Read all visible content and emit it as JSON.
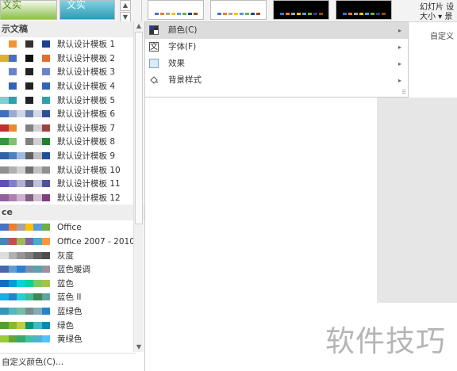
{
  "ribbon": {
    "thumb1_text": "文实",
    "thumb2_text": "文实",
    "slide_size_line1": "幻灯片 设",
    "slide_size_line2": "大小 ▾ 景",
    "group_label": "自定义"
  },
  "sections": {
    "document": "示文稿",
    "office": "ce"
  },
  "document_themes": [
    {
      "label": "默认设计模板 1",
      "colors": [
        "#ffffff",
        "#f29530",
        "#ffffff",
        "#333333",
        "#ffffff",
        "#1f3f8f"
      ]
    },
    {
      "label": "默认设计模板 2",
      "colors": [
        "#e0b030",
        "#4a6fc0",
        "#ffffff",
        "#111111",
        "#ffffff",
        "#e07030"
      ]
    },
    {
      "label": "默认设计模板 3",
      "colors": [
        "#ffffff",
        "#6b83c8",
        "#ffffff",
        "#222222",
        "#ffffff",
        "#6b83c8"
      ]
    },
    {
      "label": "默认设计模板 4",
      "colors": [
        "#ffffff",
        "#3264b4",
        "#ffffff",
        "#222222",
        "#ffffff",
        "#3264b4"
      ]
    },
    {
      "label": "默认设计模板 5",
      "colors": [
        "#7fcfcf",
        "#30a0a8",
        "#ffffff",
        "#222222",
        "#ffffff",
        "#30a0a8"
      ]
    },
    {
      "label": "默认设计模板 6",
      "colors": [
        "#3f6fbf",
        "#9aaad0",
        "#cfd6e8",
        "#7080b0",
        "#d0d8e8",
        "#304e98"
      ]
    },
    {
      "label": "默认设计模板 7",
      "colors": [
        "#c03030",
        "#e09030",
        "#ffffff",
        "#808080",
        "#d0d0d0",
        "#a04040"
      ]
    },
    {
      "label": "默认设计模板 8",
      "colors": [
        "#2f9a3a",
        "#80c070",
        "#ffffff",
        "#808080",
        "#d0d0d0",
        "#208030"
      ]
    },
    {
      "label": "默认设计模板 9",
      "colors": [
        "#3060a8",
        "#5080c0",
        "#a0b8e0",
        "#606060",
        "#c0c0c0",
        "#204e98"
      ]
    },
    {
      "label": "默认设计模板 10",
      "colors": [
        "#909090",
        "#b0b0b0",
        "#d0d0d0",
        "#707070",
        "#c0c0c0",
        "#909090"
      ]
    },
    {
      "label": "默认设计模板 11",
      "colors": [
        "#6050b0",
        "#8080c0",
        "#b0b0d0",
        "#606080",
        "#c0c0e0",
        "#5050a0"
      ]
    },
    {
      "label": "默认设计模板 12",
      "colors": [
        "#9060a0",
        "#b080b0",
        "#d0b0d0",
        "#806080",
        "#d0c0d0",
        "#804080"
      ]
    }
  ],
  "office_themes": [
    {
      "label": "Office",
      "colors": [
        "#4472c4",
        "#ed7d31",
        "#a5a5a5",
        "#ffc000",
        "#5b9bd5",
        "#70ad47"
      ]
    },
    {
      "label": "Office 2007 - 2010",
      "colors": [
        "#4f81bd",
        "#c0504d",
        "#9bbb59",
        "#8064a2",
        "#4bacc6",
        "#f79646"
      ]
    },
    {
      "label": "灰度",
      "colors": [
        "#dddddd",
        "#b2b2b2",
        "#969696",
        "#808080",
        "#5f5f5f",
        "#4d4d4d"
      ]
    },
    {
      "label": "蓝色暖调",
      "colors": [
        "#4a66ac",
        "#629dd1",
        "#297fd5",
        "#7f8fa9",
        "#5aa2ae",
        "#9d90a0"
      ]
    },
    {
      "label": "蓝色",
      "colors": [
        "#0f6fc6",
        "#009dd9",
        "#0bd0d9",
        "#10cf9b",
        "#7cca62",
        "#a5c249"
      ]
    },
    {
      "label": "蓝色 II",
      "colors": [
        "#1cade4",
        "#2683c6",
        "#27ced7",
        "#42ba97",
        "#3e8853",
        "#62a39f"
      ]
    },
    {
      "label": "蓝绿色",
      "colors": [
        "#3494ba",
        "#58b6c0",
        "#75bda7",
        "#7a8c8e",
        "#84acb6",
        "#2683c6"
      ]
    },
    {
      "label": "绿色",
      "colors": [
        "#549e39",
        "#8ab833",
        "#c0cf3a",
        "#029676",
        "#4ab5c4",
        "#0989b1"
      ]
    },
    {
      "label": "黄绿色",
      "colors": [
        "#99cb38",
        "#63a537",
        "#37a76f",
        "#44c1a3",
        "#4eb3cf",
        "#51c3f9"
      ]
    }
  ],
  "custom_colors_label": "自定义颜色(C)...",
  "menu": {
    "items": [
      {
        "label": "颜色(C)",
        "icon": "palette-icon"
      },
      {
        "label": "字体(F)",
        "icon": "font-icon"
      },
      {
        "label": "效果",
        "icon": "effects-icon"
      },
      {
        "label": "背景样式",
        "icon": "paint-bucket-icon"
      }
    ],
    "arrow": "▸",
    "grip": "⠿"
  },
  "watermark": "软件技巧"
}
